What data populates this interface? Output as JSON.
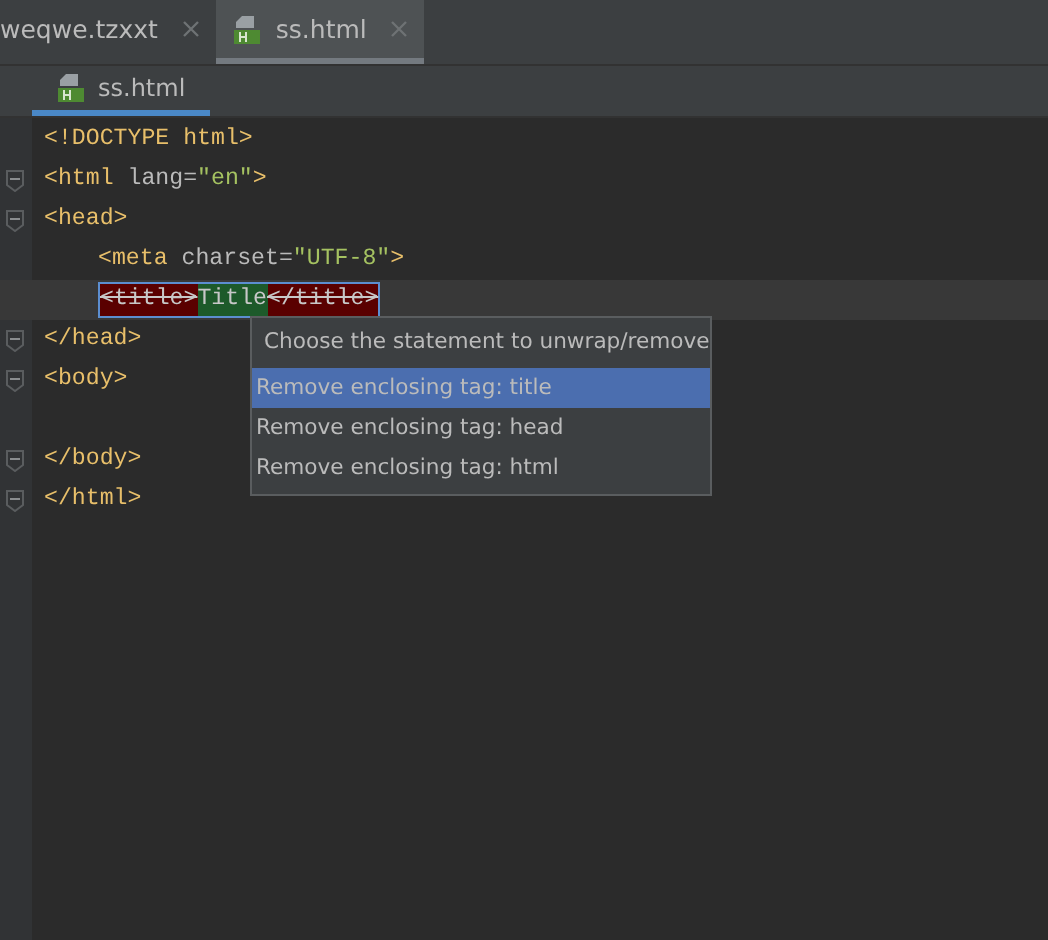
{
  "tabs": [
    {
      "label": "weqwe.tzxxt",
      "selected": false,
      "html_icon": false
    },
    {
      "label": "ss.html",
      "selected": true,
      "html_icon": true
    }
  ],
  "breadcrumb": {
    "label": "ss.html"
  },
  "lines": [
    {
      "fold": false,
      "current": false,
      "indented": false,
      "preview": false,
      "tokens": [
        {
          "text": "<!DOCTYPE html>",
          "kind": "tag"
        }
      ]
    },
    {
      "fold": true,
      "current": false,
      "indented": false,
      "preview": false,
      "tokens": [
        {
          "text": "<html ",
          "kind": "tag"
        },
        {
          "text": "lang=",
          "kind": "attr"
        },
        {
          "text": "\"en\"",
          "kind": "value"
        },
        {
          "text": ">",
          "kind": "tag"
        }
      ]
    },
    {
      "fold": true,
      "current": false,
      "indented": false,
      "preview": false,
      "tokens": [
        {
          "text": "<head>",
          "kind": "tag"
        }
      ]
    },
    {
      "fold": false,
      "current": false,
      "indented": true,
      "preview": false,
      "tokens": [
        {
          "text": "<meta ",
          "kind": "tag"
        },
        {
          "text": "charset=",
          "kind": "attr"
        },
        {
          "text": "\"UTF-8\"",
          "kind": "value"
        },
        {
          "text": ">",
          "kind": "tag"
        }
      ]
    },
    {
      "fold": false,
      "current": true,
      "indented": true,
      "preview": true,
      "tokens": [
        {
          "text": "<title>",
          "kind": "removed"
        },
        {
          "text": "Title",
          "kind": "kept"
        },
        {
          "text": "</title>",
          "kind": "removed"
        }
      ]
    },
    {
      "fold": true,
      "current": false,
      "indented": false,
      "preview": false,
      "tokens": [
        {
          "text": "</head>",
          "kind": "tag"
        }
      ]
    },
    {
      "fold": true,
      "current": false,
      "indented": false,
      "preview": false,
      "tokens": [
        {
          "text": "<body>",
          "kind": "tag"
        }
      ]
    },
    {
      "fold": false,
      "current": false,
      "indented": false,
      "preview": false
    },
    {
      "fold": true,
      "current": false,
      "indented": false,
      "preview": false,
      "tokens": [
        {
          "text": "</body>",
          "kind": "tag"
        }
      ]
    },
    {
      "fold": true,
      "current": false,
      "indented": false,
      "preview": false,
      "tokens": [
        {
          "text": "</html>",
          "kind": "tag"
        }
      ]
    }
  ],
  "popup": {
    "title": "Choose the statement to unwrap/remove",
    "items": [
      {
        "label": "Remove enclosing tag: title",
        "selected": true
      },
      {
        "label": "Remove enclosing tag: head",
        "selected": false
      },
      {
        "label": "Remove enclosing tag: html",
        "selected": false
      }
    ]
  }
}
